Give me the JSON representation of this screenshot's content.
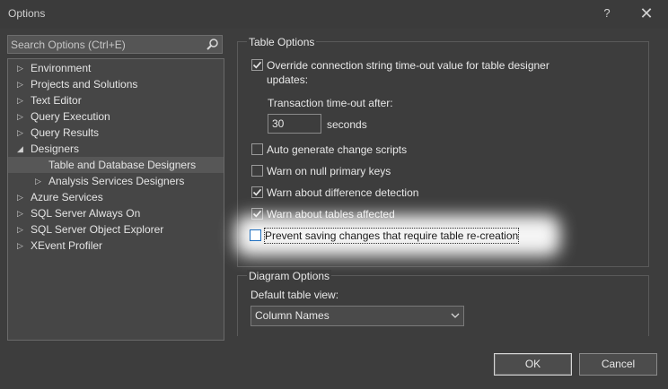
{
  "window": {
    "title": "Options",
    "help_glyph": "?",
    "close_glyph": "✕"
  },
  "search": {
    "placeholder": "Search Options (Ctrl+E)",
    "value": ""
  },
  "tree": {
    "items": [
      {
        "label": "Environment",
        "expanded": false
      },
      {
        "label": "Projects and Solutions",
        "expanded": false
      },
      {
        "label": "Text Editor",
        "expanded": false
      },
      {
        "label": "Query Execution",
        "expanded": false
      },
      {
        "label": "Query Results",
        "expanded": false
      },
      {
        "label": "Designers",
        "expanded": true
      },
      {
        "label": "Table and Database Designers",
        "selected": true
      },
      {
        "label": "Analysis Services Designers",
        "expanded": false
      },
      {
        "label": "Azure Services",
        "expanded": false
      },
      {
        "label": "SQL Server Always On",
        "expanded": false
      },
      {
        "label": "SQL Server Object Explorer",
        "expanded": false
      },
      {
        "label": "XEvent Profiler",
        "expanded": false
      }
    ]
  },
  "table_options": {
    "title": "Table Options",
    "override_timeout": {
      "label_line1": "Override connection string time-out value for table designer",
      "label_line2": "updates:",
      "checked": true
    },
    "timeout_label": "Transaction time-out after:",
    "timeout_value": "30",
    "timeout_unit": "seconds",
    "checks": [
      {
        "label": "Auto generate change scripts",
        "checked": false
      },
      {
        "label": "Warn on null primary keys",
        "checked": false
      },
      {
        "label": "Warn about difference detection",
        "checked": true
      },
      {
        "label": "Warn about tables affected",
        "checked": true
      },
      {
        "label": "Prevent saving changes that require table re-creation",
        "checked": false
      }
    ]
  },
  "diagram_options": {
    "title": "Diagram Options",
    "default_view_label": "Default table view:",
    "default_view_value": "Column Names"
  },
  "buttons": {
    "ok": "OK",
    "cancel": "Cancel"
  }
}
